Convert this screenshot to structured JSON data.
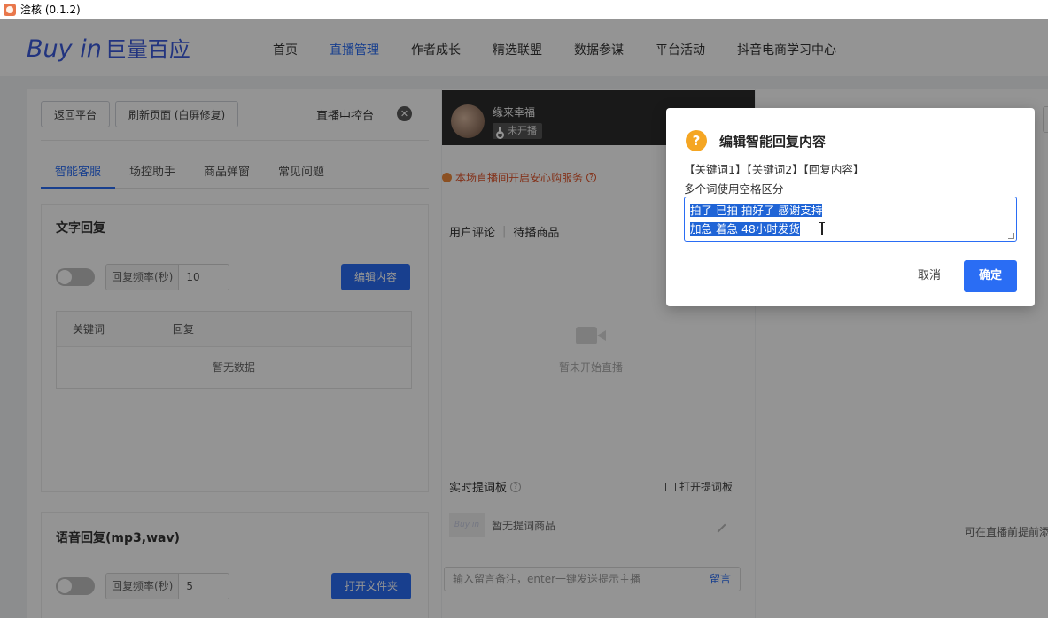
{
  "window": {
    "title": "淦核 (0.1.2)"
  },
  "header": {
    "logo_en": "Buy in",
    "logo_cn": "巨量百应",
    "nav": [
      {
        "label": "首页",
        "active": false
      },
      {
        "label": "直播管理",
        "active": true
      },
      {
        "label": "作者成长",
        "active": false
      },
      {
        "label": "精选联盟",
        "active": false
      },
      {
        "label": "数据参谋",
        "active": false
      },
      {
        "label": "平台活动",
        "active": false
      },
      {
        "label": "抖音电商学习中心",
        "active": false
      }
    ]
  },
  "left": {
    "back_button": "返回平台",
    "refresh_button": "刷新页面 (白屏修复)",
    "panel_title": "直播中控台",
    "tabs": [
      "智能客服",
      "场控助手",
      "商品弹窗",
      "常见问题"
    ],
    "text_reply": {
      "title": "文字回复",
      "freq_label": "回复频率(秒)",
      "freq_value": "10",
      "edit_button": "编辑内容",
      "col_keyword": "关键词",
      "col_reply": "回复",
      "empty": "暂无数据"
    },
    "voice_reply": {
      "title": "语音回复(mp3,wav)",
      "freq_label": "回复频率(秒)",
      "freq_value": "5",
      "open_button": "打开文件夹"
    }
  },
  "middle": {
    "streamer_name": "缘来幸福",
    "status_badge": "未开播",
    "safe_notice": "本场直播间开启安心购服务",
    "tab_comments": "用户评论",
    "tab_products": "待播商品",
    "not_started": "暂未开始直播",
    "prompter_title": "实时提词板",
    "open_prompter": "打开提词板",
    "thumb_text": "Buy in",
    "no_product": "暂无提词商品",
    "comment_placeholder": "输入留言备注，enter一键发送提示主播",
    "comment_send": "留言"
  },
  "right": {
    "hint": "可在直播前提前添"
  },
  "dialog": {
    "title": "编辑智能回复内容",
    "format_hint": "【关键词1】【关键词2】【回复内容】",
    "sub_hint": "多个词使用空格区分",
    "text_line1": "拍了 已拍 拍好了 感谢支持",
    "text_line2": "加急 着急 48小时发货",
    "cancel": "取消",
    "ok": "确定"
  },
  "colors": {
    "primary": "#2a6df4",
    "warning": "#f5a623",
    "notice": "#e2572d"
  }
}
